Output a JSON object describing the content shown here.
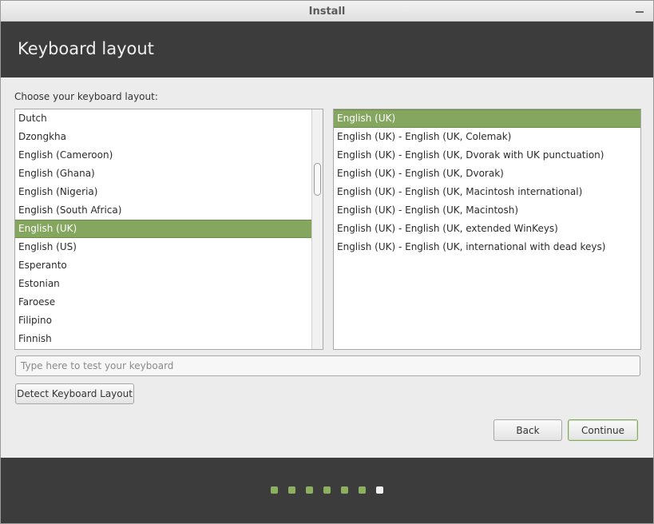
{
  "window": {
    "title": "Install"
  },
  "header": {
    "heading": "Keyboard layout"
  },
  "prompt": "Choose your keyboard layout:",
  "layouts": [
    {
      "label": "Dutch",
      "selected": false
    },
    {
      "label": "Dzongkha",
      "selected": false
    },
    {
      "label": "English (Cameroon)",
      "selected": false
    },
    {
      "label": "English (Ghana)",
      "selected": false
    },
    {
      "label": "English (Nigeria)",
      "selected": false
    },
    {
      "label": "English (South Africa)",
      "selected": false
    },
    {
      "label": "English (UK)",
      "selected": true
    },
    {
      "label": "English (US)",
      "selected": false
    },
    {
      "label": "Esperanto",
      "selected": false
    },
    {
      "label": "Estonian",
      "selected": false
    },
    {
      "label": "Faroese",
      "selected": false
    },
    {
      "label": "Filipino",
      "selected": false
    },
    {
      "label": "Finnish",
      "selected": false
    }
  ],
  "variants": [
    {
      "label": "English (UK)",
      "selected": true
    },
    {
      "label": "English (UK) - English (UK, Colemak)",
      "selected": false
    },
    {
      "label": "English (UK) - English (UK, Dvorak with UK punctuation)",
      "selected": false
    },
    {
      "label": "English (UK) - English (UK, Dvorak)",
      "selected": false
    },
    {
      "label": "English (UK) - English (UK, Macintosh international)",
      "selected": false
    },
    {
      "label": "English (UK) - English (UK, Macintosh)",
      "selected": false
    },
    {
      "label": "English (UK) - English (UK, extended WinKeys)",
      "selected": false
    },
    {
      "label": "English (UK) - English (UK, international with dead keys)",
      "selected": false
    }
  ],
  "test_input": {
    "placeholder": "Type here to test your keyboard",
    "value": ""
  },
  "buttons": {
    "detect": "Detect Keyboard Layout",
    "back": "Back",
    "continue": "Continue"
  },
  "progress": {
    "total_steps": 7,
    "current_step": 7
  },
  "colors": {
    "accent": "#85a65f",
    "header_bg": "#3c3c3c",
    "step_done": "#8cb060",
    "step_current": "#f2f2f2"
  }
}
